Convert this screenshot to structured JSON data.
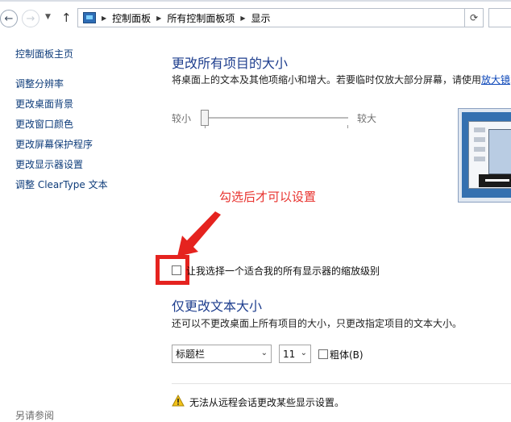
{
  "address": {
    "crumbs": [
      "控制面板",
      "所有控制面板项",
      "显示"
    ]
  },
  "sidebar": {
    "home": "控制面板主页",
    "links": [
      "调整分辨率",
      "更改桌面背景",
      "更改窗口颜色",
      "更改屏幕保护程序",
      "更改显示器设置",
      "调整 ClearType 文本"
    ],
    "see_also": "另请参阅"
  },
  "size_section": {
    "title": "更改所有项目的大小",
    "description": "将桌面上的文本及其他项缩小和增大。若要临时仅放大部分屏幕，请使用",
    "magnifier_link": "放大镜",
    "slider_min": "较小",
    "slider_max": "较大",
    "slider_value": 0
  },
  "annotation": {
    "text": "勾选后才可以设置",
    "color": "#e5231f"
  },
  "custom_scaling": {
    "checked": false,
    "label": "让我选择一个适合我的所有显示器的缩放级别"
  },
  "text_section": {
    "title": "仅更改文本大小",
    "description": "还可以不更改桌面上所有项目的大小，只更改指定项目的文本大小。",
    "item_select": "标题栏",
    "size_select": "11",
    "bold_checked": false,
    "bold_label": "粗体(B)"
  },
  "warning": {
    "text": "无法从远程会话更改某些显示设置。"
  },
  "icons": [
    "back-icon",
    "forward-icon",
    "up-arrow-icon",
    "control-panel-icon",
    "refresh-icon",
    "warning-icon",
    "arrow-annotation"
  ]
}
